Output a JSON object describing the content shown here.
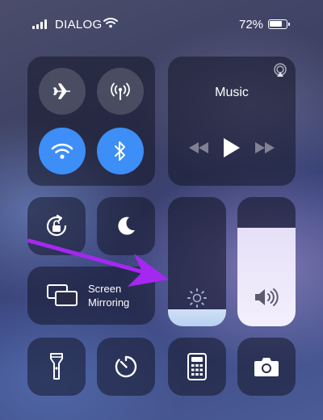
{
  "status_bar": {
    "carrier": "DIALOG",
    "battery_percent": "72%",
    "battery_level": 0.72,
    "signal_bars": 4
  },
  "connectivity": {
    "airplane_mode": {
      "icon": "airplane-icon",
      "state": "off"
    },
    "cellular_data": {
      "icon": "antenna-icon",
      "state": "off"
    },
    "wifi": {
      "icon": "wifi-icon",
      "state": "on"
    },
    "bluetooth": {
      "icon": "bluetooth-icon",
      "state": "on"
    },
    "active_color": "#3d8ef7"
  },
  "music": {
    "title": "Music",
    "airplay_icon": "airplay-icon",
    "controls": [
      "rewind-icon",
      "play-icon",
      "fast-forward-icon"
    ]
  },
  "toggles": {
    "orientation_lock": {
      "icon": "rotation-lock-icon",
      "state": "off"
    },
    "do_not_disturb": {
      "icon": "moon-icon",
      "state": "off"
    }
  },
  "screen_mirroring": {
    "line1": "Screen",
    "line2": "Mirroring",
    "icon": "screen-mirroring-icon"
  },
  "brightness": {
    "icon": "sun-icon",
    "level": 0.13
  },
  "volume": {
    "icon": "speaker-icon",
    "level": 0.76
  },
  "shortcuts": [
    "flashlight-icon",
    "timer-icon",
    "calculator-icon",
    "camera-icon"
  ],
  "annotation": {
    "icon": "arrow-annotation",
    "color": "#a528f0"
  }
}
